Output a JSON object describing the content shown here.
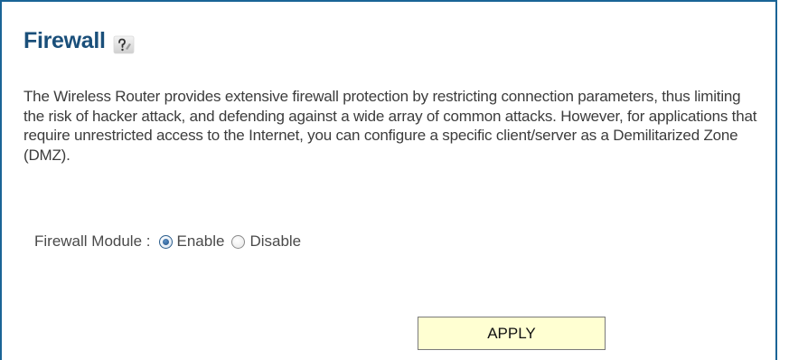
{
  "header": {
    "title": "Firewall",
    "help_icon": "help-question-icon"
  },
  "description": "The Wireless Router provides extensive firewall protection by restricting connection parameters, thus limiting the risk of hacker attack, and defending against a wide array of common attacks. However, for applications that require unrestricted access to the Internet, you can configure a specific client/server as a Demilitarized Zone (DMZ).",
  "firewall_module": {
    "label": "Firewall Module :",
    "options": [
      {
        "label": "Enable",
        "selected": true
      },
      {
        "label": "Disable",
        "selected": false
      }
    ]
  },
  "actions": {
    "apply_label": "APPLY"
  },
  "colors": {
    "border": "#1a6496",
    "title": "#1a4f7a",
    "button_bg": "#ffffd2"
  }
}
